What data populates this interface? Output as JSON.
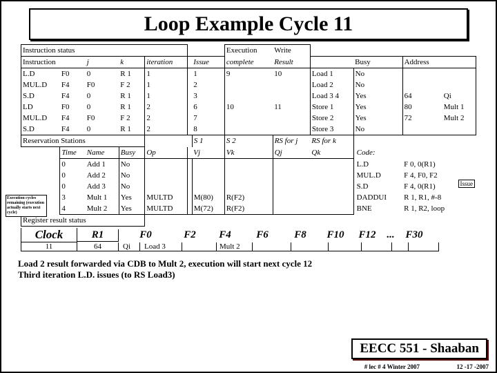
{
  "title": "Loop Example Cycle 11",
  "section1": "Instruction status",
  "hdr": {
    "instr": "Instruction",
    "j": "j",
    "k": "k",
    "iter": "iteration",
    "issue": "Issue",
    "exec": "Execution",
    "complete": "complete",
    "write": "Write",
    "result": "Result",
    "busy": "Busy",
    "addr": "Address"
  },
  "instr": [
    {
      "op": "L.D",
      "dst": "F0",
      "j": "0",
      "k": "R 1",
      "iter": "1",
      "issue": "1",
      "exec": "9",
      "wr": "10",
      "unit": "Load 1",
      "busy": "No",
      "addr": "",
      "extra": ""
    },
    {
      "op": "MUL.D",
      "dst": "F4",
      "j": "F0",
      "k": "F 2",
      "iter": "1",
      "issue": "2",
      "exec": "",
      "wr": "",
      "unit": "Load 2",
      "busy": "No",
      "addr": "",
      "extra": ""
    },
    {
      "op": "S.D",
      "dst": "F4",
      "j": "0",
      "k": "R 1",
      "iter": "1",
      "issue": "3",
      "exec": "",
      "wr": "",
      "unit": "Load 3",
      "busy": "Yes",
      "addr": "64",
      "extra": "Qi"
    },
    {
      "op": "LD",
      "dst": "F0",
      "j": "0",
      "k": "R 1",
      "iter": "2",
      "issue": "6",
      "exec": "10",
      "wr": "11",
      "unit": "Store 1",
      "busy": "Yes",
      "addr": "80",
      "extra": "Mult 1"
    },
    {
      "op": "MUL.D",
      "dst": "F4",
      "j": "F0",
      "k": "F 2",
      "iter": "2",
      "issue": "7",
      "exec": "",
      "wr": "",
      "unit": "Store 2",
      "busy": "Yes",
      "addr": "72",
      "extra": "Mult 2"
    },
    {
      "op": "S.D",
      "dst": "F4",
      "j": "0",
      "k": "R 1",
      "iter": "2",
      "issue": "8",
      "exec": "",
      "wr": "",
      "unit": "Store 3",
      "busy": "No",
      "addr": "",
      "extra": ""
    }
  ],
  "rs_hdr": {
    "title": "Reservation Stations",
    "time": "Time",
    "name": "Name",
    "busy": "Busy",
    "op": "Op",
    "s1": "S 1",
    "vj": "Vj",
    "s2": "S 2",
    "vk": "Vk",
    "rsj": "RS for j",
    "qj": "Qj",
    "rsk": "RS for k",
    "qk": "Qk",
    "code": "Code:"
  },
  "rs": [
    {
      "time": "0",
      "name": "Add 1",
      "busy": "No",
      "op": "",
      "vj": "",
      "vk": "",
      "qj": "",
      "qk": "",
      "c1": "L.D",
      "c2": "F 0, 0(R1)"
    },
    {
      "time": "0",
      "name": "Add 2",
      "busy": "No",
      "op": "",
      "vj": "",
      "vk": "",
      "qj": "",
      "qk": "",
      "c1": "MUL.D",
      "c2": "F 4, F0, F2"
    },
    {
      "time": "0",
      "name": "Add 3",
      "busy": "No",
      "op": "",
      "vj": "",
      "vk": "",
      "qj": "",
      "qk": "",
      "c1": "S.D",
      "c2": "F 4, 0(R1)"
    },
    {
      "time": "3",
      "name": "Mult 1",
      "busy": "Yes",
      "op": "MULTD",
      "vj": "M(80)",
      "vk": "R(F2)",
      "qj": "",
      "qk": "",
      "c1": "DADDUI",
      "c2": "R 1, R1, #-8"
    },
    {
      "time": "4",
      "name": "Mult 2",
      "busy": "Yes",
      "op": "MULTD",
      "vj": "M(72)",
      "vk": "R(F2)",
      "qj": "",
      "qk": "",
      "c1": "BNE",
      "c2": "R 1, R2, loop"
    }
  ],
  "load3_extra": "4",
  "exec_note": "Execution cycles remaining (execution actually starts next cycle)",
  "issue_note": "Issue",
  "reg_hdr": "Register result status",
  "clock_lbl": "Clock",
  "clock_val": "11",
  "reg_r1": "R1",
  "reg_r1v": "64",
  "regs": [
    "F0",
    "F2",
    "F4",
    "F6",
    "F8",
    "F10",
    "F12",
    "...",
    "F30"
  ],
  "qi_lbl": "Qi",
  "qi": {
    "f0": "Load 3",
    "f4": "Mult 2"
  },
  "note1": "Load 2  result forwarded via  CDB  to  Mult 2, execution will start next cycle 12",
  "note2": "Third iteration L.D. issues (to RS Load3)",
  "footer": "EECC 551 - Shaaban",
  "pageno": "#  lec # 4  Winter 2007",
  "date": "12 -17 -2007"
}
